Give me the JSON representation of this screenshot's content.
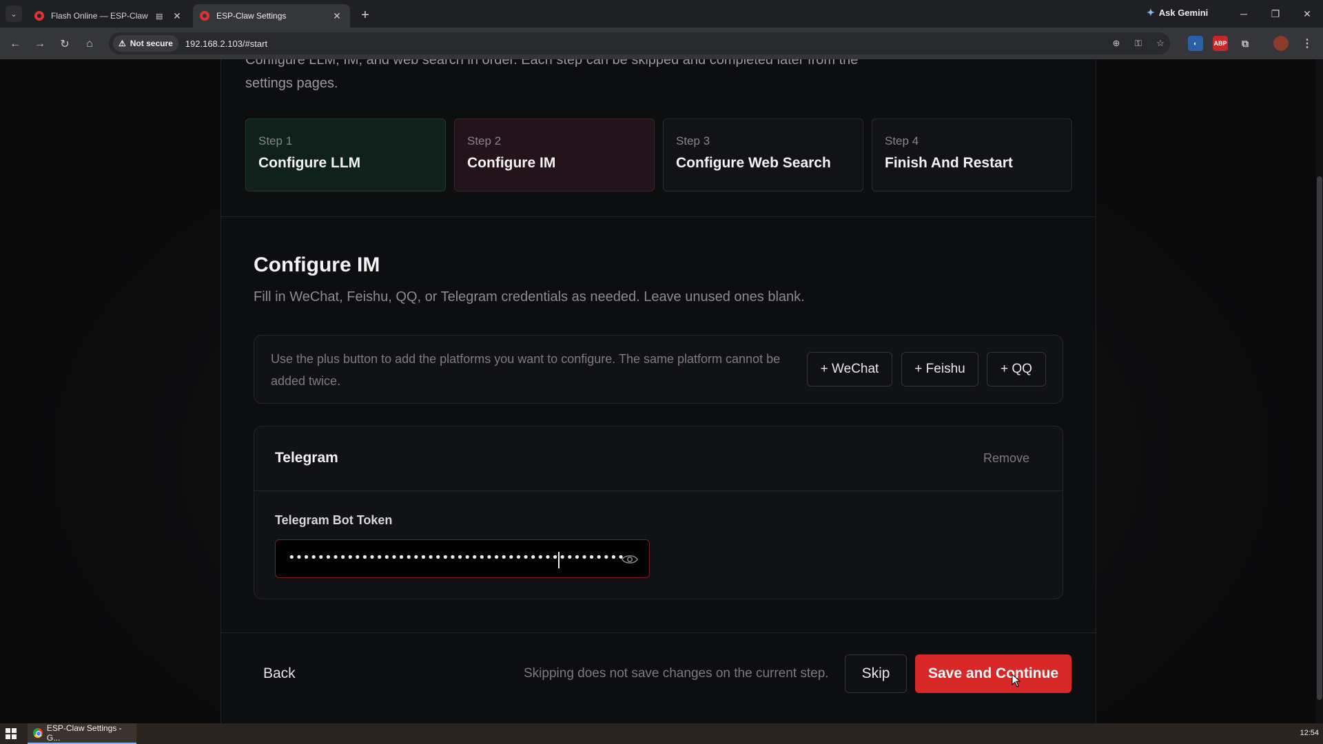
{
  "browser": {
    "tabs": [
      {
        "title": "Flash Online — ESP-Claw",
        "active": false
      },
      {
        "title": "ESP-Claw Settings",
        "active": true
      }
    ],
    "gemini_label": "Ask Gemini",
    "security_label": "Not secure",
    "url": "192.168.2.103/#start"
  },
  "page": {
    "intro_text": "Configure LLM, IM, and web search in order. Each step can be skipped and completed later from the settings pages.",
    "steps": [
      {
        "num": "Step 1",
        "name": "Configure LLM",
        "state": "done"
      },
      {
        "num": "Step 2",
        "name": "Configure IM",
        "state": "current"
      },
      {
        "num": "Step 3",
        "name": "Configure Web Search",
        "state": "pending"
      },
      {
        "num": "Step 4",
        "name": "Finish And Restart",
        "state": "pending"
      }
    ],
    "section": {
      "title": "Configure IM",
      "description": "Fill in WeChat, Feishu, QQ, or Telegram credentials as needed. Leave unused ones blank."
    },
    "add_platforms": {
      "hint": "Use the plus button to add the platforms you want to configure. The same platform cannot be added twice.",
      "buttons": [
        "+ WeChat",
        "+ Feishu",
        "+ QQ"
      ]
    },
    "telegram": {
      "title": "Telegram",
      "remove_label": "Remove",
      "token_label": "Telegram Bot Token",
      "token_masked": "••••••••••••••••••••••••••••••••••••••••••••••"
    },
    "footer": {
      "back_label": "Back",
      "skip_note": "Skipping does not save changes on the current step.",
      "skip_label": "Skip",
      "save_label": "Save and Continue"
    }
  },
  "taskbar": {
    "item_label": "ESP-Claw Settings - G...",
    "clock": "12:54"
  },
  "colors": {
    "accent": "#d92828",
    "step_done_bg": "#10201a",
    "step_current_bg": "#22141a"
  }
}
